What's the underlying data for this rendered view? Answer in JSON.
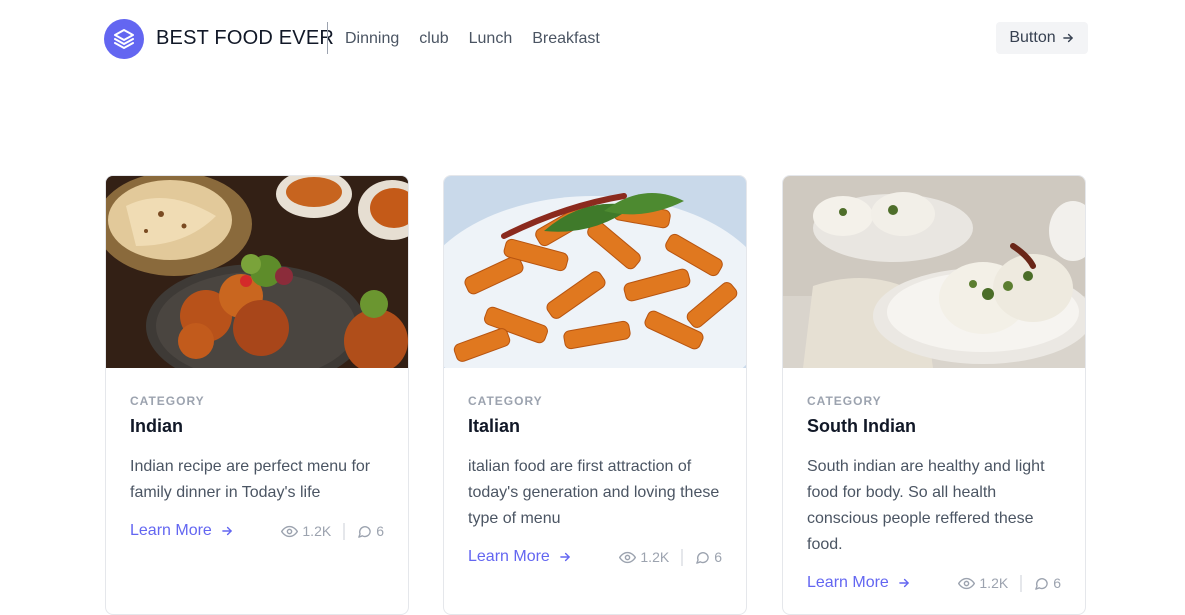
{
  "header": {
    "brand": "BEST FOOD EVER",
    "logo_icon": "stacked-layers-icon",
    "nav": [
      "Dinning",
      "club",
      "Lunch",
      "Breakfast"
    ],
    "button_label": "Button",
    "button_icon": "arrow-right-icon"
  },
  "colors": {
    "accent": "#6366f1",
    "text_primary": "#111827",
    "text_secondary": "#4b5563",
    "muted": "#9ca3af"
  },
  "cards": [
    {
      "category": "CATEGORY",
      "title": "Indian",
      "description": "Indian recipe are perfect menu for family dinner in Today's life",
      "link": "Learn More",
      "views": "1.2K",
      "comments": "6",
      "image": "indian-food-photo"
    },
    {
      "category": "CATEGORY",
      "title": "Italian",
      "description": "italian food are first attraction of today's generation and loving these type of menu",
      "link": "Learn More",
      "views": "1.2K",
      "comments": "6",
      "image": "italian-pasta-photo"
    },
    {
      "category": "CATEGORY",
      "title": "South Indian",
      "description": "South indian are healthy and light food for body. So all health conscious people reffered these food.",
      "link": "Learn More",
      "views": "1.2K",
      "comments": "6",
      "image": "south-indian-idli-photo"
    }
  ]
}
